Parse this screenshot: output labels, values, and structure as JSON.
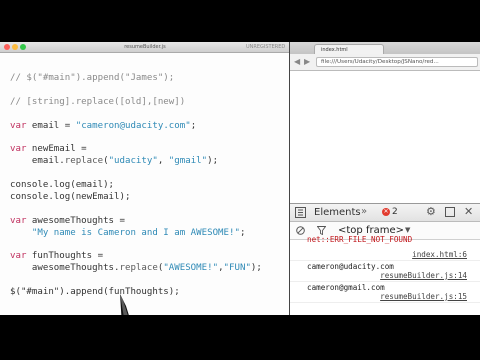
{
  "editor": {
    "tab_title": "resumeBuilder.js",
    "tab_extra": "UNREGISTERED",
    "code_lines": [
      {
        "t": "comment",
        "text": "// $(\"#main\").append(\"James\");"
      },
      {
        "t": "blank",
        "text": ""
      },
      {
        "t": "comment",
        "text": "// [string].replace([old],[new])"
      },
      {
        "t": "blank",
        "text": ""
      },
      {
        "t": "decl",
        "kw": "var",
        "name": " email = ",
        "str": "\"cameron@udacity.com\"",
        "end": ";"
      },
      {
        "t": "blank",
        "text": ""
      },
      {
        "t": "decl2",
        "kw": "var",
        "name": " newEmail ="
      },
      {
        "t": "call",
        "pre": "    email.",
        "fn": "replace",
        "args_a": "(",
        "s1": "\"udacity\"",
        "mid": ", ",
        "s2": "\"gmail\"",
        "end": ");"
      },
      {
        "t": "blank",
        "text": ""
      },
      {
        "t": "plain",
        "text": "console.log(email);"
      },
      {
        "t": "plain",
        "text": "console.log(newEmail);"
      },
      {
        "t": "blank",
        "text": ""
      },
      {
        "t": "decl2",
        "kw": "var",
        "name": " awesomeThoughts ="
      },
      {
        "t": "strline",
        "pre": "    ",
        "str": "\"My name is Cameron and I am AWESOME!\"",
        "end": ";"
      },
      {
        "t": "blank",
        "text": ""
      },
      {
        "t": "decl2",
        "kw": "var",
        "name": " funThoughts ="
      },
      {
        "t": "call",
        "pre": "    awesomeThoughts.",
        "fn": "replace",
        "args_a": "(",
        "s1": "\"AWESOME!\"",
        "mid": ",",
        "s2": "\"FUN\"",
        "end": ");"
      },
      {
        "t": "blank",
        "text": ""
      },
      {
        "t": "plain",
        "text": "$(\"#main\").append(funThoughts);"
      }
    ]
  },
  "browser": {
    "tab_title": "index.html",
    "url": "file:///Users/Udacity/Desktop/JSNano/red..."
  },
  "devtools": {
    "tab_elements": "Elements",
    "more": "»",
    "error_count": "2",
    "frame": "<top frame>",
    "logs": [
      {
        "type": "err",
        "msg": "net::ERR_FILE_NOT_FOUND",
        "src": "index.html:6"
      },
      {
        "type": "log",
        "msg": "cameron@udacity.com",
        "src": "resumeBuilder.js:14"
      },
      {
        "type": "log",
        "msg": "cameron@gmail.com",
        "src": "resumeBuilder.js:15"
      }
    ]
  },
  "colors": {
    "keyword": "#c0305f",
    "string": "#2f8ab6",
    "comment": "#8a8a8a",
    "error": "#e23b2e"
  }
}
